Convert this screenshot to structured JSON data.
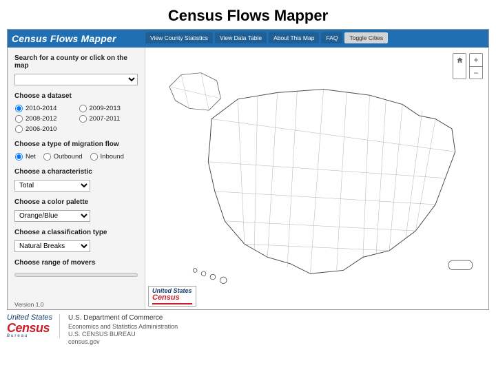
{
  "page_title": "Census Flows Mapper",
  "header": {
    "app_title": "Census Flows Mapper"
  },
  "tabs": {
    "view_stats": "View County Statistics",
    "view_data": "View Data Table",
    "about": "About This Map",
    "faq": "FAQ",
    "toggle": "Toggle Cities"
  },
  "sidebar": {
    "search_label": "Search for a county or click on the map",
    "search_value": "",
    "dataset_label": "Choose a dataset",
    "datasets": {
      "d0": "2010-2014",
      "d1": "2009-2013",
      "d2": "2008-2012",
      "d3": "2007-2011",
      "d4": "2006-2010"
    },
    "flow_label": "Choose a type of migration flow",
    "flows": {
      "net": "Net",
      "out": "Outbound",
      "in": "Inbound"
    },
    "char_label": "Choose a characteristic",
    "char_value": "Total",
    "palette_label": "Choose a color palette",
    "palette_value": "Orange/Blue",
    "class_label": "Choose a classification type",
    "class_value": "Natural Breaks",
    "range_label": "Choose range of movers"
  },
  "version": "Version 1.0",
  "map_logo": {
    "l1": "United States",
    "l2": "Census"
  },
  "footer": {
    "logo1": "United States",
    "logo2": "Census",
    "logo3": "Bureau",
    "dept": "U.S. Department of Commerce",
    "line2": "Economics and Statistics Administration",
    "line3": "U.S. CENSUS BUREAU",
    "line4": "census.gov"
  }
}
